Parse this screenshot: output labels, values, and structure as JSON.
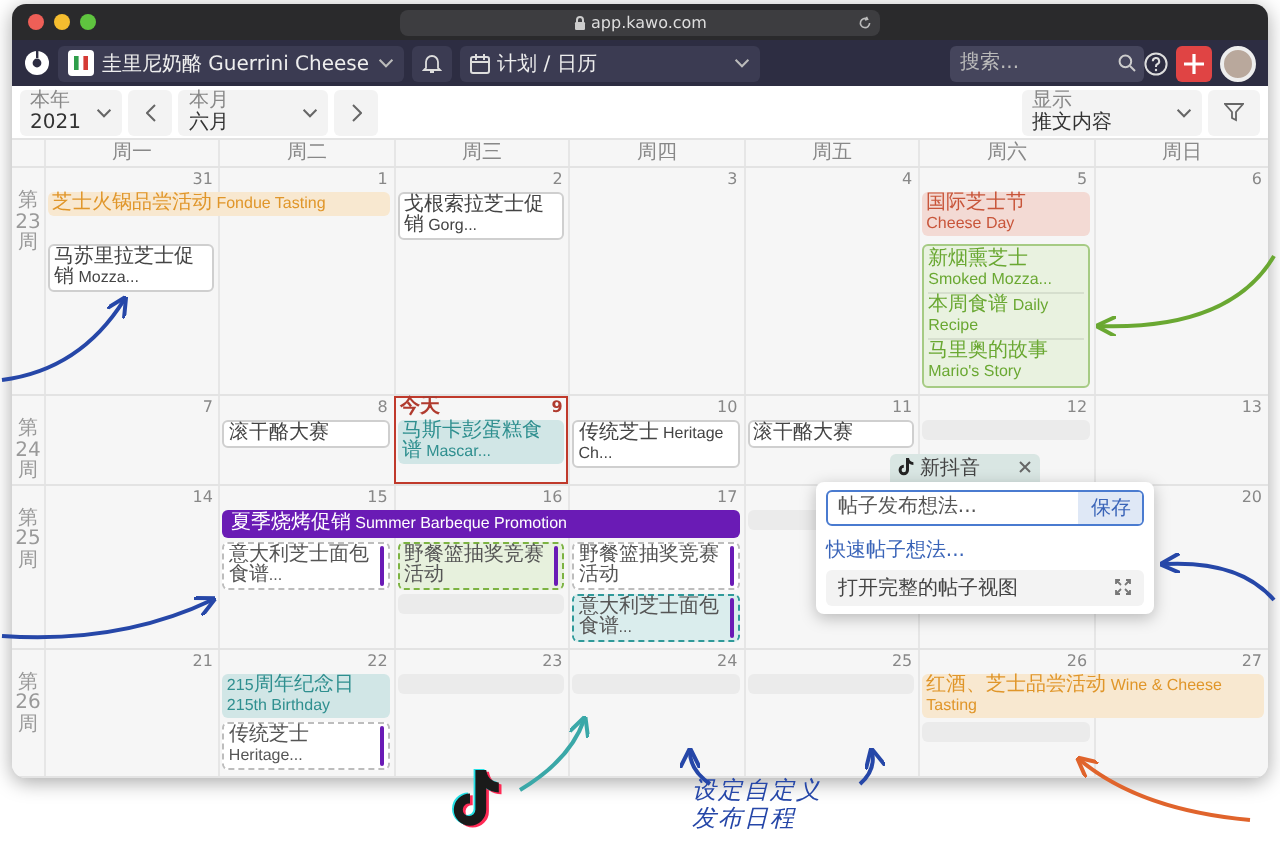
{
  "window": {
    "url": "app.kawo.com"
  },
  "app_bar": {
    "brand": "圭里尼奶酪 Guerrini Cheese",
    "nav": "计划 / 日历",
    "search": {
      "placeholder": "搜索..."
    }
  },
  "toolbar": {
    "year": {
      "label": "本年",
      "value": "2021"
    },
    "month": {
      "label": "本月",
      "value": "六月"
    },
    "display": {
      "label": "显示",
      "value": "推文内容"
    }
  },
  "weekdays": [
    "周一",
    "周二",
    "周三",
    "周四",
    "周五",
    "周六",
    "周日"
  ],
  "weeks": [
    {
      "label": "第23周",
      "days": [
        {
          "date": "31",
          "today": false,
          "events": [
            {
              "kind": "banner",
              "text": "芝士火锅品尝活动 Fondue Tasting",
              "color": "#e0962a"
            },
            {
              "kind": "post",
              "text": "马苏里拉芝士促销 Mozza..."
            }
          ]
        },
        {
          "date": "1",
          "today": false
        },
        {
          "date": "2",
          "today": false,
          "events": [
            {
              "kind": "post",
              "text": "戈根索拉芝士促销 Gorg..."
            }
          ]
        },
        {
          "date": "3",
          "today": false
        },
        {
          "date": "4",
          "today": false
        },
        {
          "date": "5",
          "today": false,
          "events": [
            {
              "kind": "banner",
              "text": "国际芝士节 Cheese Day",
              "color": "#c8553a"
            },
            {
              "kind": "group",
              "color": "#6aa832",
              "items": [
                "新烟熏芝士 Smoked Mozza...",
                "本周食谱 Daily Recipe",
                "马里奥的故事 Mario's Story"
              ]
            }
          ]
        },
        {
          "date": "6",
          "today": false
        }
      ]
    },
    {
      "label": "第24周",
      "days": [
        {
          "date": "7",
          "today": false
        },
        {
          "date": "8",
          "today": false,
          "events": [
            {
              "kind": "post",
              "text": "滚干酪大赛"
            }
          ]
        },
        {
          "date": "9",
          "today": true,
          "today_label": "今天",
          "events": [
            {
              "kind": "banner",
              "text": "马斯卡彭蛋糕食谱 Mascar...",
              "color": "#2f8f8f"
            }
          ]
        },
        {
          "date": "10",
          "today": false,
          "events": [
            {
              "kind": "post",
              "text": "传统芝士 Heritage Ch..."
            }
          ]
        },
        {
          "date": "11",
          "today": false,
          "events": [
            {
              "kind": "post",
              "text": "滚干酪大赛"
            }
          ]
        },
        {
          "date": "12",
          "today": false,
          "events": [
            {
              "kind": "placeholder"
            }
          ]
        },
        {
          "date": "13",
          "today": false
        }
      ]
    },
    {
      "label": "第25周",
      "days": [
        {
          "date": "14",
          "today": false
        },
        {
          "date": "15",
          "today": false,
          "events": [
            {
              "kind": "bar",
              "text": "夏季烧烤促销 Summer Barbeque Promotion",
              "color": "#6a1bb5"
            },
            {
              "kind": "draft",
              "text": "意大利芝士面包食谱..."
            }
          ]
        },
        {
          "date": "16",
          "today": false,
          "events": [
            {
              "kind": "draft",
              "text": "野餐篮抽奖竞赛活动",
              "color": "#7cb342"
            },
            {
              "kind": "placeholder"
            }
          ]
        },
        {
          "date": "17",
          "today": false,
          "events": [
            {
              "kind": "draft",
              "text": "野餐篮抽奖竞赛活动"
            },
            {
              "kind": "draft",
              "text": "意大利芝士面包食谱...",
              "color": "#2f9a9a"
            }
          ]
        },
        {
          "today": false,
          "events": [
            {
              "kind": "placeholder"
            }
          ]
        },
        {
          "today": false
        },
        {
          "date": "20",
          "today": false
        }
      ]
    },
    {
      "label": "第26周",
      "days": [
        {
          "date": "21",
          "today": false
        },
        {
          "date": "22",
          "today": false,
          "events": [
            {
              "kind": "banner",
              "text": "215周年纪念日 215th Birthday",
              "color": "#2f8f8f"
            },
            {
              "kind": "draft",
              "text": "传统芝士 Heritage..."
            }
          ]
        },
        {
          "date": "23",
          "today": false,
          "events": [
            {
              "kind": "placeholder"
            }
          ]
        },
        {
          "date": "24",
          "today": false,
          "events": [
            {
              "kind": "placeholder"
            }
          ]
        },
        {
          "date": "25",
          "today": false,
          "events": [
            {
              "kind": "placeholder"
            }
          ]
        },
        {
          "date": "26",
          "today": false,
          "events": [
            {
              "kind": "banner",
              "text": "红酒、芝士品尝活动 Wine & Cheese Tasting",
              "color": "#e0962a"
            },
            {
              "kind": "placeholder"
            }
          ]
        },
        {
          "date": "27",
          "today": false
        }
      ]
    }
  ],
  "popup": {
    "chip": "新抖音",
    "input": {
      "placeholder": "帖子发布想法..."
    },
    "save": "保存",
    "link": "快速帖子想法...",
    "open_full": "打开完整的帖子视图"
  },
  "annotation": {
    "lines": [
      "设定自定义",
      "发布日程"
    ]
  }
}
